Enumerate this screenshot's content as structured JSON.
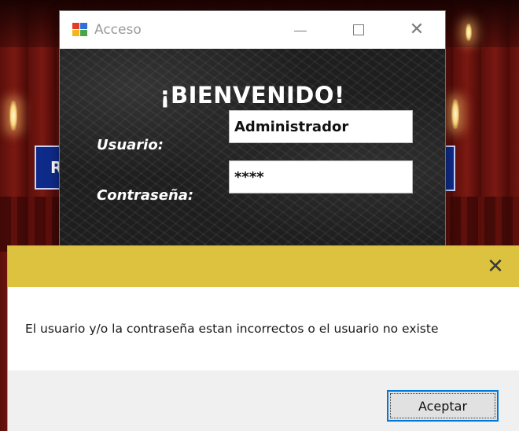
{
  "background_app": {
    "partial_button_label": "R"
  },
  "login_window": {
    "title": "Acceso",
    "welcome": "¡BIENVENIDO!",
    "user_label": "Usuario:",
    "user_value": "Administrador",
    "password_label": "Contraseña:",
    "password_value": "****"
  },
  "message_box": {
    "text": "El usuario y/o la contraseña estan incorrectos o el usuario no existe",
    "ok_label": "Aceptar",
    "close_glyph": "✕"
  },
  "window_controls": {
    "close_glyph": "✕"
  },
  "colors": {
    "message_titlebar": "#dcc23f",
    "ok_button_border": "#0078d7",
    "background_button": "#0f2b8a"
  }
}
